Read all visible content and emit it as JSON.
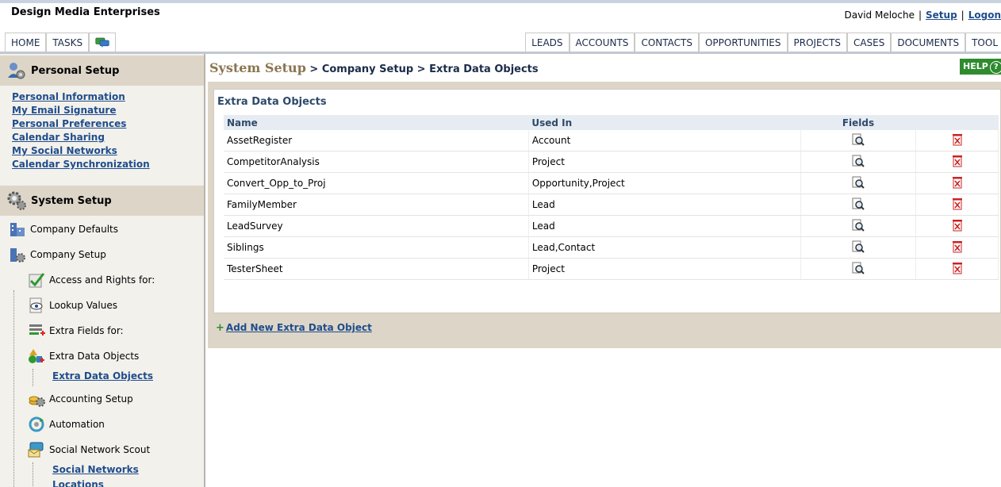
{
  "company_name": "Design Media Enterprises",
  "user": {
    "name": "David Meloche",
    "setup": "Setup",
    "logout": "Logon"
  },
  "nav_left": [
    "HOME",
    "TASKS"
  ],
  "nav_right": [
    "LEADS",
    "ACCOUNTS",
    "CONTACTS",
    "OPPORTUNITIES",
    "PROJECTS",
    "CASES",
    "DOCUMENTS",
    "TOOL"
  ],
  "sidebar": {
    "personal_title": "Personal Setup",
    "personal_links": [
      "Personal Information",
      "My Email Signature",
      "Personal Preferences",
      "Calendar Sharing",
      "My Social Networks",
      "Calendar Synchronization"
    ],
    "system_title": "System Setup",
    "company_defaults": "Company Defaults",
    "company_setup": "Company Setup",
    "access_rights": "Access and Rights for:",
    "lookup_values": "Lookup Values",
    "extra_fields": "Extra Fields for:",
    "extra_data_objects": "Extra Data Objects",
    "extra_data_objects_sub": "Extra Data Objects",
    "accounting_setup": "Accounting Setup",
    "automation": "Automation",
    "social_network_scout": "Social Network Scout",
    "social_networks_sub": "Social Networks",
    "locations_sub": "Locations"
  },
  "breadcrumb": {
    "root": "System Setup",
    "rest": " > Company Setup > Extra Data Objects"
  },
  "help_label": "HELP",
  "panel": {
    "title": "Extra Data Objects",
    "headers": {
      "name": "Name",
      "used_in": "Used In",
      "fields": "Fields"
    },
    "rows": [
      {
        "name": "AssetRegister",
        "used_in": "Account"
      },
      {
        "name": "CompetitorAnalysis",
        "used_in": "Project"
      },
      {
        "name": "Convert_Opp_to_Proj",
        "used_in": "Opportunity,Project"
      },
      {
        "name": "FamilyMember",
        "used_in": "Lead"
      },
      {
        "name": "LeadSurvey",
        "used_in": "Lead"
      },
      {
        "name": "Siblings",
        "used_in": "Lead,Contact"
      },
      {
        "name": "TesterSheet",
        "used_in": "Project"
      }
    ],
    "add_label": "Add New Extra Data Object"
  },
  "colors": {
    "accent_green": "#2e8b2e",
    "link_blue": "#1f4d8c",
    "panel_tan": "#ddd6c8"
  }
}
